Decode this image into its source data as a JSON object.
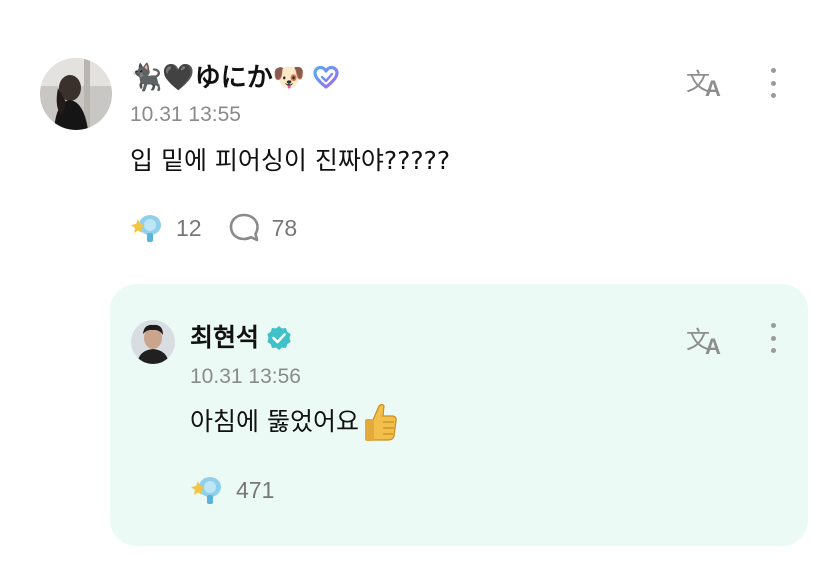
{
  "post": {
    "author_name": "🐈‍⬛🖤ゆにか🐶",
    "timestamp": "10.31 13:55",
    "text": "입 밑에 피어싱이 진짜야?????",
    "likes": "12",
    "comments": "78"
  },
  "reply": {
    "author_name": "최현석",
    "timestamp": "10.31 13:56",
    "text": "아침에 뚫었어요",
    "emoji": "👍",
    "likes": "471"
  },
  "colors": {
    "reply_bg": "#ecfaf6",
    "verified": "#3ec1c9",
    "membership_badge": "#7b7bf0"
  },
  "icons": {
    "translate": "translate-icon",
    "more": "more-vertical-icon",
    "like": "like-sparkle-icon",
    "comment": "comment-bubble-icon",
    "verified": "verified-badge-icon",
    "membership": "membership-heart-badge-icon"
  }
}
